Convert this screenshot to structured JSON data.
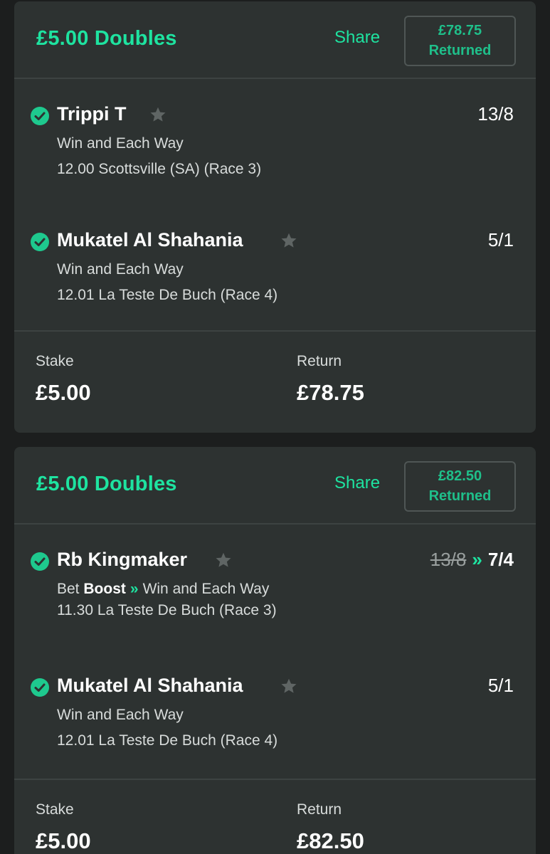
{
  "bets": [
    {
      "title": "£5.00 Doubles",
      "share_label": "Share",
      "returned_amount": "£78.75",
      "returned_label": "Returned",
      "selections": [
        {
          "name": "Trippi T",
          "odds": "13/8",
          "market": "Win and Each Way",
          "event": "12.00 Scottsville (SA) (Race 3)"
        },
        {
          "name": "Mukatel Al Shahania",
          "odds": "5/1",
          "market": "Win and Each Way",
          "event": "12.01 La Teste De Buch (Race 4)"
        }
      ],
      "stake_label": "Stake",
      "stake_value": "£5.00",
      "return_label": "Return",
      "return_value": "£78.75"
    },
    {
      "title": "£5.00 Doubles",
      "share_label": "Share",
      "returned_amount": "£82.50",
      "returned_label": "Returned",
      "selections": [
        {
          "name": "Rb Kingmaker",
          "odds_old": "13/8",
          "odds_new": "7/4",
          "boost_prefix": "Bet",
          "boost_word": "Boost",
          "market": "Win and Each Way",
          "event": "11.30 La Teste De Buch (Race 3)"
        },
        {
          "name": "Mukatel Al Shahania",
          "odds": "5/1",
          "market": "Win and Each Way",
          "event": "12.01 La Teste De Buch (Race 4)"
        }
      ],
      "stake_label": "Stake",
      "stake_value": "£5.00",
      "return_label": "Return",
      "return_value": "£82.50"
    }
  ],
  "colors": {
    "accent": "#1ee3a0",
    "card_bg": "#2d3231",
    "page_bg": "#1c1e1e"
  },
  "icons": {
    "check": "check-circle-icon",
    "star": "star-icon",
    "boost": "double-chevron-right-icon"
  }
}
